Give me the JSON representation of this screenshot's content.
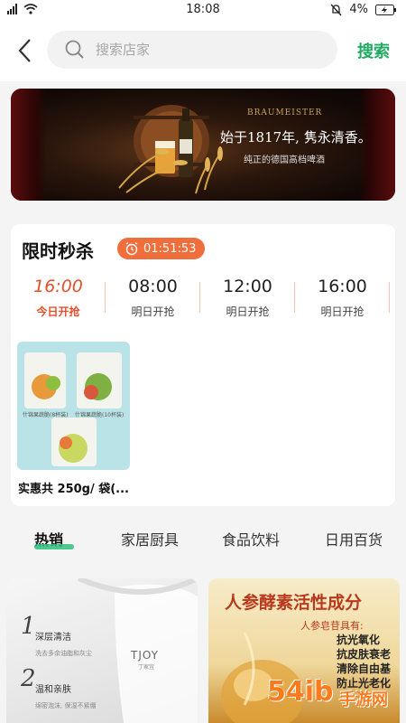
{
  "status": {
    "time": "18:08",
    "battery": "4%"
  },
  "header": {
    "search_placeholder": "搜索店家",
    "search_button": "搜索"
  },
  "banner": {
    "brand": "BRAUMEISTER",
    "tagline": "始于1817年, 隽永清香。",
    "sub": "纯正的德国高档啤酒",
    "bottle_label": "Bier Ander"
  },
  "flash_sale": {
    "title": "限时秒杀",
    "timer": "01:51:53",
    "slots": [
      {
        "time": "16:00",
        "status": "今日开抢",
        "active": true
      },
      {
        "time": "08:00",
        "status": "明日开抢",
        "active": false
      },
      {
        "time": "12:00",
        "status": "明日开抢",
        "active": false
      },
      {
        "time": "16:00",
        "status": "明日开抢",
        "active": false
      }
    ],
    "product": {
      "name": "实惠共 250g/ 袋(...",
      "bag1": "什锦果蔬脆(8杯装)",
      "bag2": "什锦果蔬脆(10杯装)"
    }
  },
  "tabs": [
    "热销",
    "家居厨具",
    "食品饮料",
    "日用百货"
  ],
  "cards": {
    "left": {
      "item1_title": "深层清洁",
      "item1_sub": "洗去多余油脂和灰尘",
      "item2_title": "温和亲肤",
      "item2_sub": "绵密泡沫, 保湿不紧绷",
      "brand": "TJOY",
      "brand_sub": "丁家宜"
    },
    "right": {
      "title": "人参酵素活性成分",
      "subtitle": "人参皂苷具有:",
      "benefits": [
        "抗光氧化",
        "抗皮肤衰老",
        "清除自由基",
        "防止光老化"
      ]
    }
  },
  "watermark": {
    "text": "手游网",
    "sub": "54ib"
  },
  "colors": {
    "accent_green": "#1faa63",
    "sale_red": "#e2502c",
    "timer_bg": "#f06e3c"
  }
}
